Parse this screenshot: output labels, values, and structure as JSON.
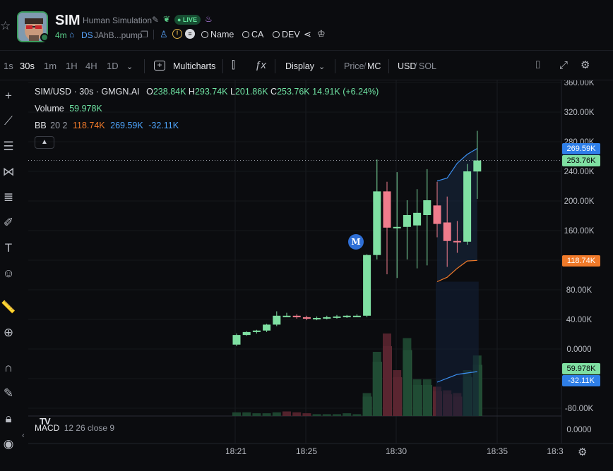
{
  "header": {
    "symbol": "SIM",
    "token_name": "Human Simulation",
    "live_badge": "LIVE",
    "age": "4m",
    "ds_label": "DS",
    "ca_short": "JAhB...pump",
    "search_links": [
      "Name",
      "CA",
      "DEV"
    ],
    "icons": [
      "star-icon",
      "edit-icon",
      "leaf-icon",
      "fire-icon",
      "home-icon",
      "copy-icon",
      "user-icon",
      "warning-icon",
      "menu-icon",
      "share-icon",
      "crown-icon"
    ]
  },
  "toolbar": {
    "timeframes": [
      "1s",
      "30s",
      "1m",
      "1H",
      "4H",
      "1D"
    ],
    "active_timeframe": "30s",
    "multicharts_label": "Multicharts",
    "display_label": "Display",
    "price_label": "Price",
    "mc_label": "MC",
    "usd_label": "USD",
    "sol_label": "SOL"
  },
  "legend": {
    "pair": "SIM/USD · 30s · GMGN.AI",
    "o_label": "O",
    "o_value": "238.84K",
    "h_label": "H",
    "h_value": "293.74K",
    "l_label": "L",
    "l_value": "201.86K",
    "c_label": "C",
    "c_value": "253.76K",
    "change": "14.91K (+6.24%)",
    "volume_label": "Volume",
    "volume_value": "59.978K",
    "bb_label": "BB",
    "bb_params": "20 2",
    "bb_lower": "118.74K",
    "bb_upper": "269.59K",
    "bb_third": "-32.11K",
    "macd_label": "MACD",
    "macd_params": "12 26 close 9",
    "tv_logo": "TV"
  },
  "price_tags": {
    "bb_upper": "269.59K",
    "last_price": "253.76K",
    "bb_lower": "118.74K",
    "volume": "59.978K",
    "macd": "-32.11K"
  },
  "marker_label": "M",
  "colors": {
    "up": "#7fe0a2",
    "down": "#f07c8c",
    "vol_up": "#1f4a33",
    "vol_down": "#5a2530",
    "bb_blue": "#3b8ff0",
    "bb_orange": "#f07a2a",
    "macd_green": "#2d5a3d",
    "macd_red": "#5c2a33"
  },
  "chart_data": {
    "type": "candlestick",
    "y_ticks": [
      "360.00K",
      "320.00K",
      "280.00K",
      "240.00K",
      "200.00K",
      "160.00K",
      "120.00K",
      "80.00K",
      "40.00K",
      "0.0000",
      "-40.00K",
      "-80.00K",
      "0.0000"
    ],
    "x_ticks": [
      "18:21",
      "18:25",
      "18:30",
      "18:35",
      "18:3"
    ],
    "candles": [
      {
        "o": 5,
        "h": 20,
        "l": 3,
        "c": 18
      },
      {
        "o": 18,
        "h": 23,
        "l": 17,
        "c": 22
      },
      {
        "o": 22,
        "h": 25,
        "l": 20,
        "c": 24
      },
      {
        "o": 24,
        "h": 33,
        "l": 22,
        "c": 32
      },
      {
        "o": 32,
        "h": 50,
        "l": 30,
        "c": 44
      },
      {
        "o": 44,
        "h": 48,
        "l": 42,
        "c": 44
      },
      {
        "o": 44,
        "h": 46,
        "l": 40,
        "c": 42
      },
      {
        "o": 42,
        "h": 44,
        "l": 38,
        "c": 40
      },
      {
        "o": 40,
        "h": 43,
        "l": 38,
        "c": 41
      },
      {
        "o": 41,
        "h": 44,
        "l": 39,
        "c": 42
      },
      {
        "o": 42,
        "h": 45,
        "l": 40,
        "c": 43
      },
      {
        "o": 43,
        "h": 45,
        "l": 41,
        "c": 44
      },
      {
        "o": 44,
        "h": 46,
        "l": 42,
        "c": 44
      },
      {
        "o": 44,
        "h": 127,
        "l": 42,
        "c": 126
      },
      {
        "o": 126,
        "h": 255,
        "l": 120,
        "c": 212
      },
      {
        "o": 212,
        "h": 225,
        "l": 100,
        "c": 163
      },
      {
        "o": 163,
        "h": 238,
        "l": 95,
        "c": 164
      },
      {
        "o": 164,
        "h": 200,
        "l": 120,
        "c": 180
      },
      {
        "o": 166,
        "h": 215,
        "l": 108,
        "c": 183
      },
      {
        "o": 180,
        "h": 242,
        "l": 112,
        "c": 200
      },
      {
        "o": 193,
        "h": 225,
        "l": 150,
        "c": 168
      },
      {
        "o": 170,
        "h": 205,
        "l": 110,
        "c": 145
      },
      {
        "o": 145,
        "h": 172,
        "l": 129,
        "c": 144
      },
      {
        "o": 144,
        "h": 249,
        "l": 140,
        "c": 239
      },
      {
        "o": 238.84,
        "h": 293.74,
        "l": 201.86,
        "c": 253.76
      }
    ],
    "bb_upper": [
      {
        "i": 20,
        "v": 226
      },
      {
        "i": 21,
        "v": 230
      },
      {
        "i": 22,
        "v": 250
      },
      {
        "i": 23,
        "v": 262
      },
      {
        "i": 24,
        "v": 270
      }
    ],
    "bb_lower": [
      {
        "i": 20,
        "v": 90
      },
      {
        "i": 21,
        "v": 96
      },
      {
        "i": 22,
        "v": 108
      },
      {
        "i": 23,
        "v": 118
      },
      {
        "i": 24,
        "v": 118.74
      }
    ],
    "volume": [
      4,
      4,
      3,
      3,
      4,
      5,
      4,
      3,
      2,
      2,
      2,
      3,
      2,
      25,
      70,
      90,
      50,
      85,
      40,
      40,
      32,
      28,
      25,
      50,
      66
    ],
    "volume_up": [
      true,
      true,
      true,
      true,
      true,
      false,
      false,
      false,
      true,
      true,
      true,
      true,
      true,
      true,
      true,
      false,
      false,
      true,
      true,
      true,
      false,
      false,
      false,
      true,
      true
    ]
  }
}
